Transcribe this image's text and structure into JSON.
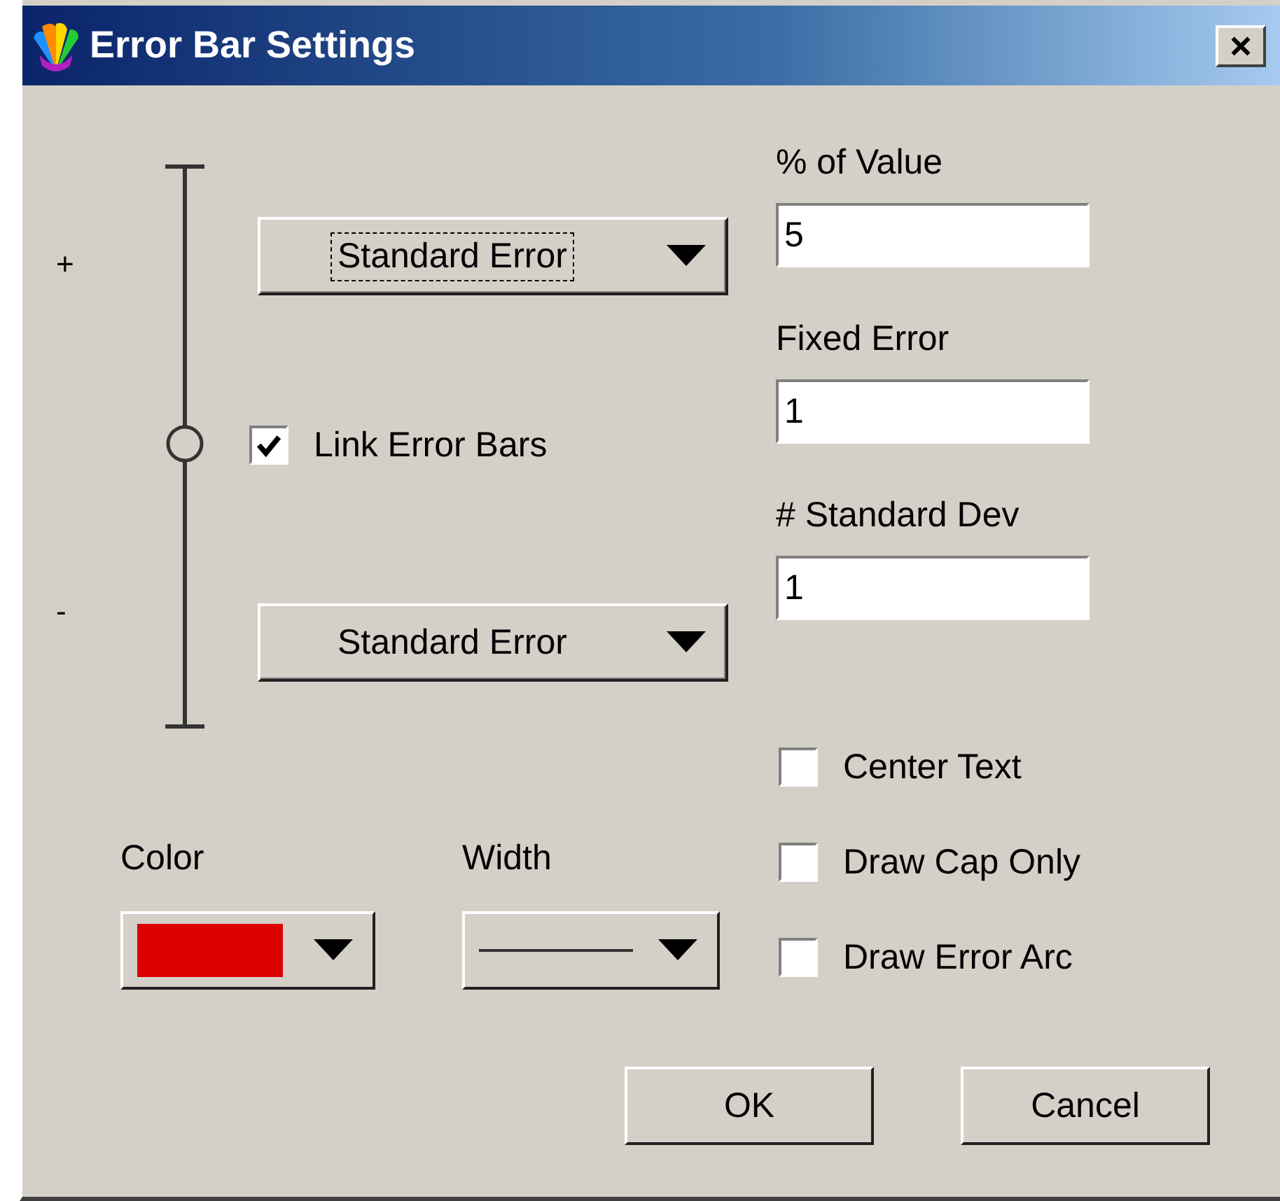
{
  "window": {
    "title": "Error Bar Settings"
  },
  "upper_error": {
    "sign": "+",
    "type": "Standard Error",
    "focused": true
  },
  "link_error_bars": {
    "label": "Link Error Bars",
    "checked": true
  },
  "lower_error": {
    "sign": "-",
    "type": "Standard Error",
    "focused": false
  },
  "fields": [
    {
      "label": "% of Value",
      "value": "5"
    },
    {
      "label": "Fixed Error",
      "value": "1"
    },
    {
      "label": "# Standard Dev",
      "value": "1"
    }
  ],
  "options": [
    {
      "label": "Center Text",
      "checked": false
    },
    {
      "label": "Draw Cap Only",
      "checked": false
    },
    {
      "label": "Draw Error Arc",
      "checked": false
    }
  ],
  "color": {
    "label": "Color",
    "color": "#dd0000"
  },
  "width": {
    "label": "Width"
  },
  "buttons": [
    {
      "label": "OK"
    },
    {
      "label": "Cancel"
    }
  ]
}
